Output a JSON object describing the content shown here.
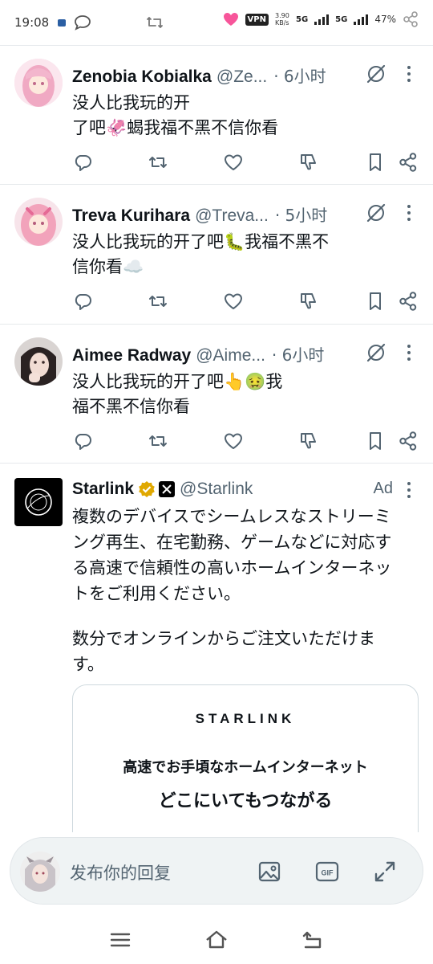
{
  "status_bar": {
    "time": "19:08",
    "vpn": "VPN",
    "speed": "3.90\nKB/s",
    "net1": "5G",
    "net2": "5G",
    "battery": "47%"
  },
  "tweets": [
    {
      "name": "Zenobia Kobialka",
      "handle": "@Ze...",
      "time": "· 6小时",
      "lines": [
        "没人比我玩的开",
        "了吧🦑蝎我福不黑不信你看"
      ]
    },
    {
      "name": "Treva Kurihara",
      "handle": "@Treva...",
      "time": "· 5小时",
      "lines": [
        "没人比我玩的开了吧🐛我福不黑不",
        "信你看☁️"
      ]
    },
    {
      "name": "Aimee Radway",
      "handle": "@Aime...",
      "time": "· 6小时",
      "lines": [
        "没人比我玩的开了吧👆🤢我",
        "福不黑不信你看"
      ]
    }
  ],
  "ad": {
    "name": "Starlink",
    "handle": "@Starlink",
    "tag": "Ad",
    "lines": [
      "複数のデバイスでシームレスなストリーミ",
      "ング再生、在宅勤務、ゲームなどに対応す",
      "る高速で信頼性の高いホームインターネッ",
      "トをご利用ください。",
      "",
      "数分でオンラインからご注文いただけま",
      "す。"
    ],
    "card": {
      "brand": "STARLINK",
      "line1": "高速でお手頃なホームインターネット",
      "line2": "どこにいてもつながる"
    }
  },
  "reply": {
    "placeholder": "发布你的回复"
  },
  "icons": {
    "reply": "reply-icon",
    "retweet": "retweet-icon",
    "like": "heart-icon",
    "dislike": "dislike-icon",
    "bookmark": "bookmark-icon",
    "share": "share-icon",
    "grok": "grok-icon",
    "more": "more-icon",
    "verified": "verified-badge-icon",
    "affiliate": "x-affiliate-icon",
    "image": "image-icon",
    "gif": "gif-icon",
    "expand": "expand-icon",
    "menu": "menu-icon",
    "home": "home-icon",
    "back": "back-icon"
  },
  "colors": {
    "text": "#0f1419",
    "secondary": "#536471",
    "verified": "#e0a800",
    "separator": "#e6e9ec",
    "reply_bg": "#eff3f4"
  }
}
